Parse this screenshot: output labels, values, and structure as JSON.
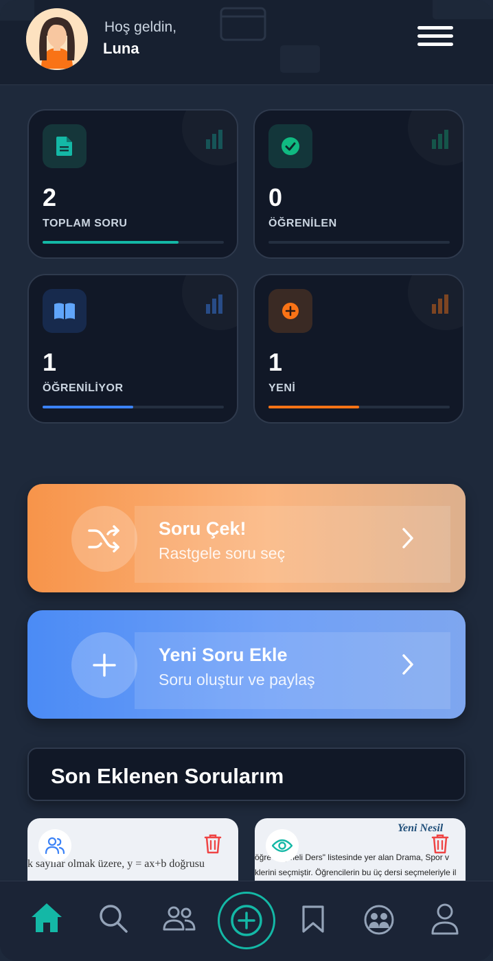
{
  "header": {
    "greeting": "Hoş geldin,",
    "username": "Luna"
  },
  "stats": [
    {
      "value": "2",
      "label": "TOPLAM SORU",
      "icon": "document-icon",
      "color": "#14b8a6",
      "progress": 0.75
    },
    {
      "value": "0",
      "label": "ÖĞRENİLEN",
      "icon": "check-circle-icon",
      "color": "#10b981",
      "progress": 0
    },
    {
      "value": "1",
      "label": "ÖĞRENİLİYOR",
      "icon": "book-icon",
      "color": "#3b82f6",
      "progress": 0.5
    },
    {
      "value": "1",
      "label": "YENİ",
      "icon": "plus-circle-icon",
      "color": "#f97316",
      "progress": 0.5
    }
  ],
  "actions": {
    "random": {
      "title": "Soru Çek!",
      "subtitle": "Rastgele soru seç",
      "icon": "shuffle-icon"
    },
    "add": {
      "title": "Yeni Soru Ekle",
      "subtitle": "Soru oluştur ve paylaş",
      "icon": "plus-icon"
    }
  },
  "recent": {
    "title": "Son Eklenen Sorularım",
    "items": [
      {
        "visibility_icon": "users-icon",
        "preview": "k sayılar olmak üzere, y = ax+b doğrusu"
      },
      {
        "visibility_icon": "eye-icon",
        "headline": "Yeni Nesil",
        "preview_line1": "öğre    Seçmeli Ders\" listesinde yer alan Drama, Spor v",
        "preview_line2": "klerini seçmiştir. Öğrencilerin bu üç dersi seçmeleriyle il"
      }
    ]
  },
  "nav": [
    {
      "name": "home-icon",
      "active": true
    },
    {
      "name": "search-icon"
    },
    {
      "name": "friends-icon"
    },
    {
      "name": "add-circle-icon"
    },
    {
      "name": "bookmark-icon"
    },
    {
      "name": "community-icon"
    },
    {
      "name": "profile-icon"
    }
  ],
  "colors": {
    "background": "#1e293b",
    "card": "#111827",
    "accent": "#14b8a6",
    "orange": "#f7944a",
    "blue": "#4b8bf5"
  }
}
